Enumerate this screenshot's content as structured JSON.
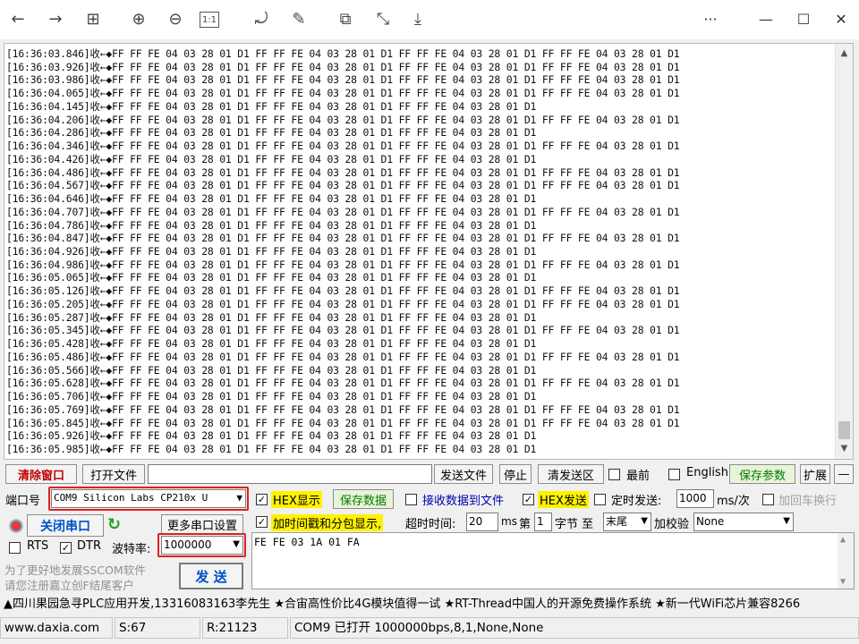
{
  "toolbar": {
    "items": [
      {
        "name": "back-icon",
        "glyph": "←"
      },
      {
        "name": "forward-icon",
        "glyph": "→"
      },
      {
        "name": "grid-icon",
        "glyph": "⊞"
      },
      {
        "name": "zoom-in-icon",
        "glyph": "⊕"
      },
      {
        "name": "zoom-out-icon",
        "glyph": "⊖"
      },
      {
        "name": "actual-size-icon",
        "glyph": "1:1"
      },
      {
        "name": "rotate-icon",
        "glyph": "⤾"
      },
      {
        "name": "edit-icon",
        "glyph": "✎"
      },
      {
        "name": "share-icon",
        "glyph": "⧉"
      },
      {
        "name": "crop-icon",
        "glyph": "⤡"
      },
      {
        "name": "save-icon",
        "glyph": "⤓"
      }
    ],
    "more": "···",
    "minimize": "—",
    "maximize": "☐",
    "close": "✕"
  },
  "receive": {
    "lines": [
      [
        "16:36:03.846",
        true
      ],
      [
        "16:36:03.926",
        true
      ],
      [
        "16:36:03.986",
        true
      ],
      [
        "16:36:04.065",
        true
      ],
      [
        "16:36:04.145",
        false
      ],
      [
        "16:36:04.206",
        true
      ],
      [
        "16:36:04.286",
        false
      ],
      [
        "16:36:04.346",
        true
      ],
      [
        "16:36:04.426",
        false
      ],
      [
        "16:36:04.486",
        true
      ],
      [
        "16:36:04.567",
        true
      ],
      [
        "16:36:04.646",
        false
      ],
      [
        "16:36:04.707",
        true
      ],
      [
        "16:36:04.786",
        false
      ],
      [
        "16:36:04.847",
        true
      ],
      [
        "16:36:04.926",
        false
      ],
      [
        "16:36:04.986",
        true
      ],
      [
        "16:36:05.065",
        false
      ],
      [
        "16:36:05.126",
        true
      ],
      [
        "16:36:05.205",
        true
      ],
      [
        "16:36:05.287",
        false
      ],
      [
        "16:36:05.345",
        true
      ],
      [
        "16:36:05.428",
        false
      ],
      [
        "16:36:05.486",
        true
      ],
      [
        "16:36:05.566",
        false
      ],
      [
        "16:36:05.628",
        true
      ],
      [
        "16:36:05.706",
        false
      ],
      [
        "16:36:05.769",
        true
      ],
      [
        "16:36:05.845",
        true
      ],
      [
        "16:36:05.926",
        false
      ],
      [
        "16:36:05.985",
        false
      ]
    ],
    "prefix": "收←◆",
    "frame": "FF FF FE 04 03 28 01 D1",
    "scroll_up": "▲",
    "scroll_down": "▼"
  },
  "row1": {
    "clear_window": "清除窗口",
    "open_file": "打开文件",
    "send_file": "发送文件",
    "stop": "停止",
    "clear_send": "清发送区",
    "topmost": "最前",
    "english": "English",
    "save_params": "保存参数",
    "expand": "扩展",
    "collapse": "—"
  },
  "row2": {
    "port_label": "端口号",
    "port_value": "COM9 Silicon Labs CP210x U",
    "hex_display": "HEX显示",
    "save_data": "保存数据",
    "recv_to_file": "接收数据到文件",
    "hex_send": "HEX发送",
    "timed_send": "定时发送:",
    "interval": "1000",
    "interval_unit": "ms/次",
    "add_crlf": "加回车换行"
  },
  "row3": {
    "close_port": "关闭串口",
    "more_settings": "更多串口设置",
    "timestamp": "加时间戳和分包显示,",
    "timeout_label": "超时时间:",
    "timeout_value": "20",
    "timeout_unit": "ms",
    "nth_label": "第",
    "nth_value": "1",
    "byte_label": "字节 至",
    "end_value": "末尾",
    "checksum_label": "加校验",
    "checksum_value": "None"
  },
  "row4": {
    "rts": "RTS",
    "dtr": "DTR",
    "baud_label": "波特率:",
    "baud_value": "1000000"
  },
  "send": {
    "text": "FE FE 03 1A 01 FA",
    "promo_1": "为了更好地发展SSCOM软件",
    "promo_2": "请您注册嘉立创F结尾客户",
    "send_button": "发  送"
  },
  "ticker": "▲四川果园急寻PLC应用开发,13316083163李先生 ★合宙高性价比4G模块值得一试 ★RT-Thread中国人的开源免费操作系统 ★新一代WiFi芯片兼容8266",
  "status": {
    "website": "www.daxia.com",
    "sent": "S:67",
    "received": "R:21123",
    "port_state": "COM9 已打开  1000000bps,8,1,None,None"
  }
}
